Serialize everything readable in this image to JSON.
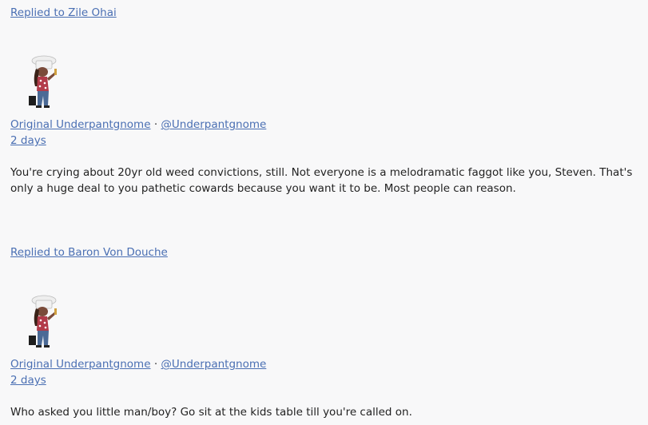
{
  "posts": [
    {
      "replied_to": "Replied to Zile Ohai",
      "author_name": "Original Underpantgnome",
      "separator": "·",
      "handle": "@Underpantgnome",
      "time": "2 days",
      "body": "You're crying about 20yr old weed convictions, still. Not everyone is a melodramatic faggot like you, Steven. That's only a huge deal to you pathetic cowards because you want it to be. Most people can reason."
    },
    {
      "replied_to": "Replied to Baron Von Douche",
      "author_name": "Original Underpantgnome",
      "separator": "·",
      "handle": "@Underpantgnome",
      "time": "2 days",
      "body": "Who asked you little man/boy? Go sit at the kids table till you're called on."
    }
  ]
}
